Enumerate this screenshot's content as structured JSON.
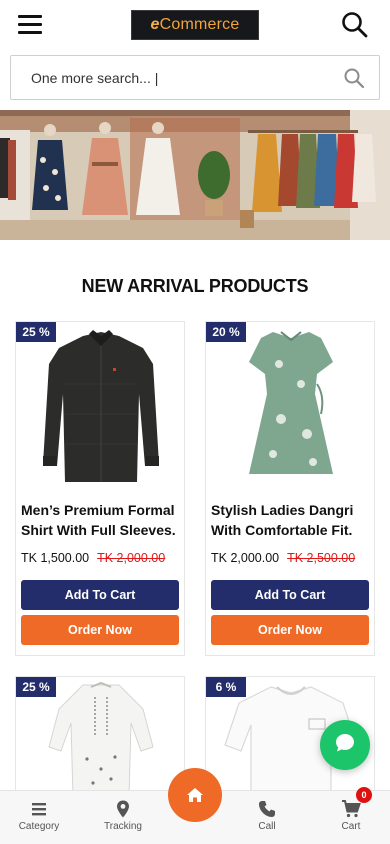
{
  "header": {
    "logo_prefix": "e",
    "logo_text": "Commerce"
  },
  "search": {
    "placeholder": "One more search... |"
  },
  "section": {
    "title": "NEW ARRIVAL PRODUCTS"
  },
  "products": [
    {
      "badge": "25 %",
      "name": "Men’s Premium Formal Shirt With Full Sleeves.",
      "price": "TK 1,500.00",
      "old_price": "TK 2,000.00",
      "cart_label": "Add To Cart",
      "order_label": "Order Now"
    },
    {
      "badge": "20 %",
      "name": "Stylish Ladies Dangri With Comfortable Fit.",
      "price": "TK 2,000.00",
      "old_price": "TK 2,500.00",
      "cart_label": "Add To Cart",
      "order_label": "Order Now"
    },
    {
      "badge": "25 %"
    },
    {
      "badge": "6 %"
    }
  ],
  "bottom_nav": {
    "category": "Category",
    "tracking": "Tracking",
    "call": "Call",
    "cart": "Cart",
    "cart_count": "0"
  },
  "icons": {
    "menu": "menu-icon",
    "search": "search-icon",
    "chat": "chat-bubble-icon",
    "home": "home-icon",
    "category": "list-icon",
    "tracking": "map-pin-icon",
    "call": "phone-icon",
    "cart": "cart-icon"
  },
  "colors": {
    "brand_navy": "#232d6b",
    "brand_orange": "#ef6a27",
    "discount_red": "#e01919",
    "chat_green": "#1cc46a",
    "logo_gold": "#f1a43a"
  }
}
